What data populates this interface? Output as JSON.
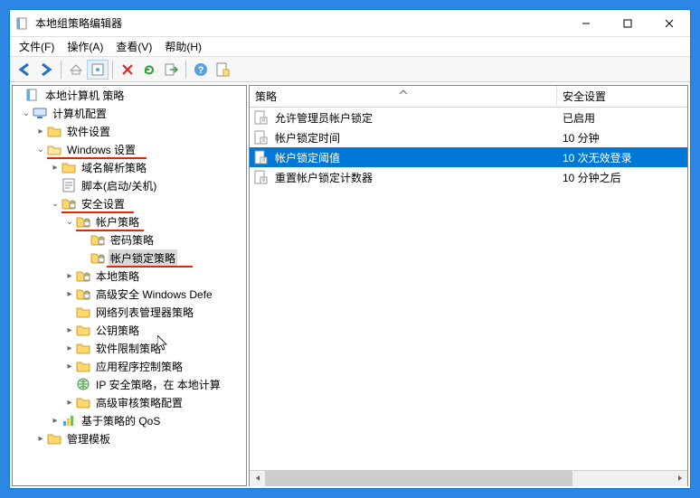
{
  "window": {
    "title": "本地组策略编辑器"
  },
  "menu": {
    "file": "文件(F)",
    "operation": "操作(A)",
    "view": "查看(V)",
    "help": "帮助(H)"
  },
  "tree": {
    "root": "本地计算机 策略",
    "computer_config": "计算机配置",
    "software_settings": "软件设置",
    "windows_settings": "Windows 设置",
    "dns_policy": "域名解析策略",
    "scripts": "脚本(启动/关机)",
    "security_settings": "安全设置",
    "account_policies": "帐户策略",
    "password_policy": "密码策略",
    "account_lockout_policy": "帐户锁定策略",
    "local_policies": "本地策略",
    "windows_defender": "高级安全 Windows Defe",
    "network_list_manager": "网络列表管理器策略",
    "public_key": "公钥策略",
    "software_restriction": "软件限制策略",
    "app_control": "应用程序控制策略",
    "ip_security": "IP 安全策略，在 本地计算",
    "audit_policy": "高级审核策略配置",
    "qos": "基于策略的 QoS",
    "admin_templates": "管理模板"
  },
  "columns": {
    "policy": "策略",
    "setting": "安全设置"
  },
  "rows": [
    {
      "policy": "允许管理员帐户锁定",
      "setting": "已启用"
    },
    {
      "policy": "帐户锁定时间",
      "setting": "10 分钟"
    },
    {
      "policy": "帐户锁定阈值",
      "setting": "10 次无效登录"
    },
    {
      "policy": "重置帐户锁定计数器",
      "setting": "10 分钟之后"
    }
  ]
}
